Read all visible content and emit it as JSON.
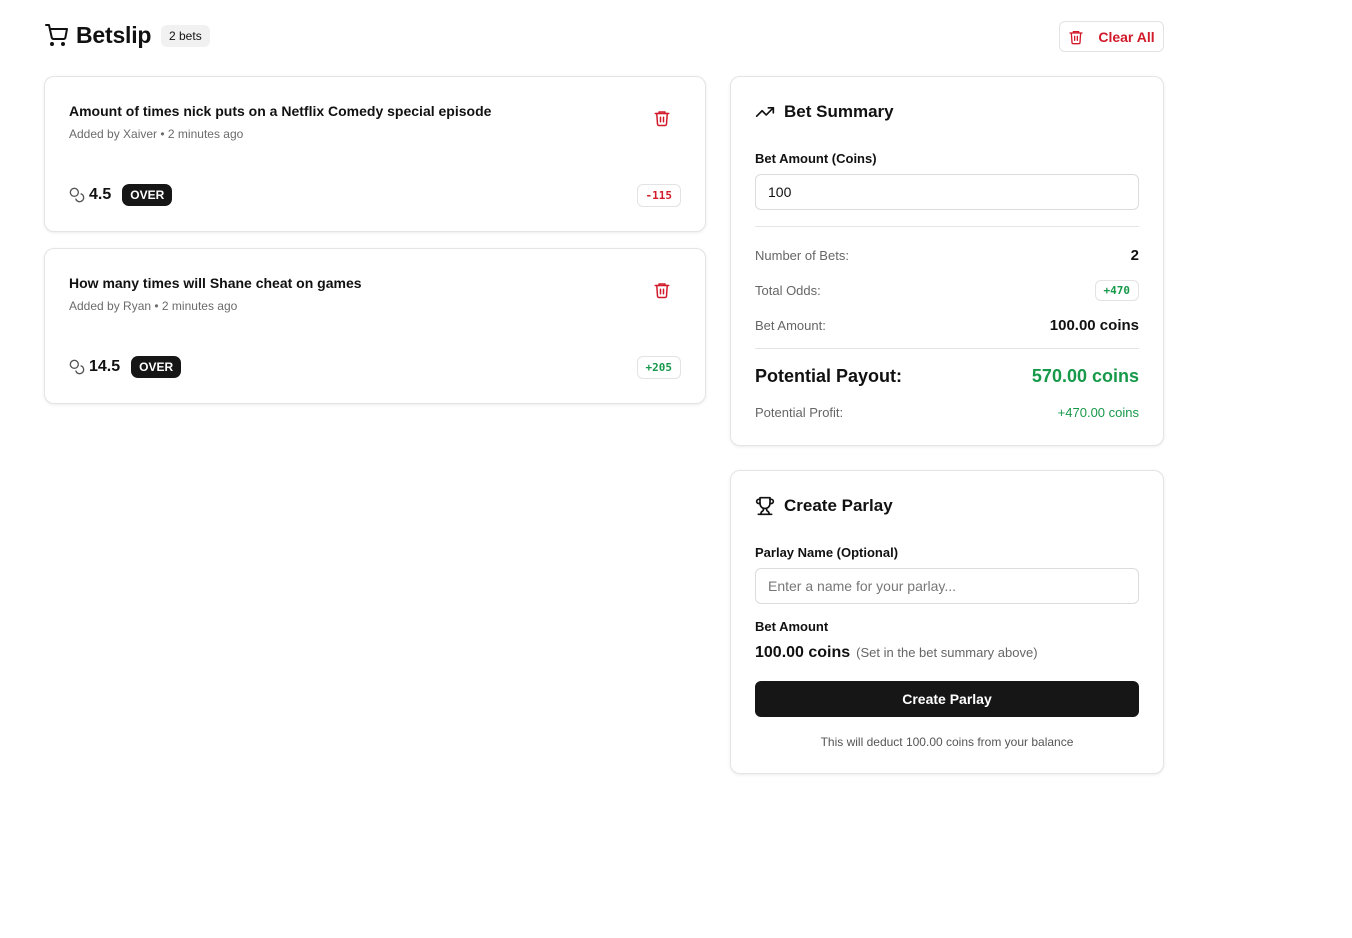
{
  "header": {
    "title": "Betslip",
    "bet_count": "2 bets",
    "clear_label": "Clear All",
    "icons": {
      "cart": "shopping-cart-icon",
      "trash": "trash-icon"
    }
  },
  "bets": [
    {
      "title": "Amount of times nick puts on a Netflix Comedy special episode",
      "meta": "Added by Xaiver • 2 minutes ago",
      "line": "4.5",
      "side": "OVER",
      "odds": "-115"
    },
    {
      "title": "How many times will Shane cheat on games",
      "meta": "Added by Ryan • 2 minutes ago",
      "line": "14.5",
      "side": "OVER",
      "odds": "+205"
    }
  ],
  "summary": {
    "title": "Bet Summary",
    "amount_label": "Bet Amount (Coins)",
    "amount_value": "100",
    "num_bets_label": "Number of Bets:",
    "num_bets_value": "2",
    "total_odds_label": "Total Odds:",
    "total_odds_value": "+470",
    "bet_amount_label": "Bet Amount:",
    "bet_amount_value": "100.00 coins",
    "payout_label": "Potential Payout:",
    "payout_value": "570.00 coins",
    "profit_label": "Potential Profit:",
    "profit_value": "+470.00 coins"
  },
  "parlay": {
    "title": "Create Parlay",
    "name_label": "Parlay Name (Optional)",
    "name_placeholder": "Enter a name for your parlay...",
    "amount_label": "Bet Amount",
    "amount_value": "100.00 coins",
    "amount_note": "(Set in the bet summary above)",
    "button_label": "Create Parlay",
    "footnote": "This will deduct 100.00 coins from your balance"
  },
  "colors": {
    "accent": "#161616",
    "danger": "#d11a2a",
    "positive": "#17994a"
  }
}
